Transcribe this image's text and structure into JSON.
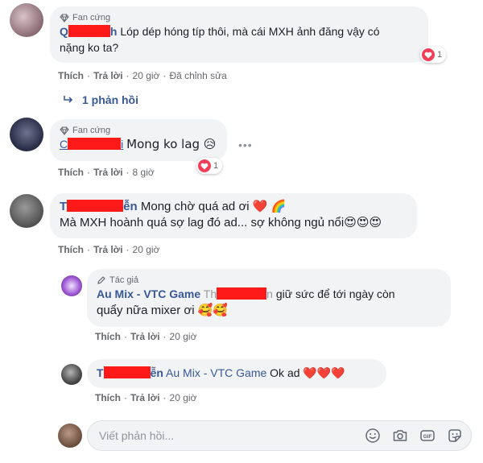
{
  "comments": [
    {
      "badge": "Fan cứng",
      "author_start": "Q",
      "author_end": "h",
      "text_line1": "Lóp dép hóng típ thôi, mà cái MXH ảnh đăng vậy có",
      "text_line2": "nặng ko ta?",
      "reaction_count": "1",
      "like": "Thích",
      "reply": "Trả lời",
      "time": "20 giờ",
      "edited": "Đã chỉnh sửa",
      "replies_link": "1 phản hồi"
    },
    {
      "badge": "Fan cứng",
      "author_start": "C",
      "author_end": "i",
      "text": "Mong ko lag 😥",
      "reaction_count": "1",
      "like": "Thích",
      "reply": "Trả lời",
      "time": "8 giờ"
    },
    {
      "author_start": "T",
      "author_end": "ễn",
      "text_line1": "Mong chờ quá ad ơi ❤️ 🌈",
      "text_line2": "Mà MXH hoành quá sợ lag đó ad... sợ không ngủ nổi😍😍😍",
      "like": "Thích",
      "reply": "Trả lời",
      "time": "20 giờ"
    }
  ],
  "replies": [
    {
      "badge": "Tác giả",
      "author": "Au Mix - VTC Game",
      "tag_start": "Th",
      "tag_end": "n",
      "text_line1": "giữ sức để tới ngày còn",
      "text_line2": "quẩy nữa mixer ơi 🥰🥰",
      "like": "Thích",
      "reply": "Trả lời",
      "time": "20 giờ"
    },
    {
      "author_start": "T",
      "author_end": "ễn",
      "tag": "Au Mix - VTC Game",
      "text": "Ok ad ❤️❤️❤️",
      "like": "Thích",
      "reply": "Trả lời",
      "time": "20 giờ"
    }
  ],
  "composer": {
    "placeholder": "Viết phản hồi...",
    "icons": [
      "emoji-icon",
      "camera-icon",
      "gif-icon",
      "sticker-icon"
    ]
  },
  "colors": {
    "name": "#385898",
    "bubble": "#f2f3f5",
    "meta": "#65676b",
    "redaction": "#ff1a1a",
    "heart": "#f33e58"
  }
}
